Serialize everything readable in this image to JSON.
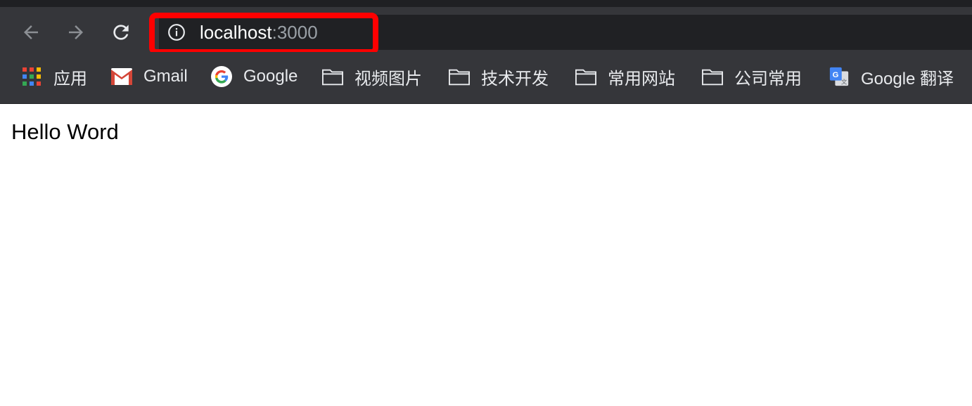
{
  "toolbar": {
    "back_icon": "arrow-left-icon",
    "forward_icon": "arrow-right-icon",
    "reload_icon": "reload-icon",
    "address": {
      "host": "localhost",
      "port": ":3000",
      "icon": "info-icon"
    }
  },
  "bookmarks": [
    {
      "label": "应用",
      "icon": "apps-grid-icon"
    },
    {
      "label": "Gmail",
      "icon": "gmail-icon"
    },
    {
      "label": "Google",
      "icon": "google-icon"
    },
    {
      "label": "视频图片",
      "icon": "folder-icon"
    },
    {
      "label": "技术开发",
      "icon": "folder-icon"
    },
    {
      "label": "常用网站",
      "icon": "folder-icon"
    },
    {
      "label": "公司常用",
      "icon": "folder-icon"
    },
    {
      "label": "Google 翻译",
      "icon": "google-translate-icon"
    }
  ],
  "page": {
    "body_text": "Hello Word"
  },
  "colors": {
    "highlight": "#ff0000",
    "toolbar_bg": "#35363a",
    "omnibox_bg": "#202124"
  }
}
